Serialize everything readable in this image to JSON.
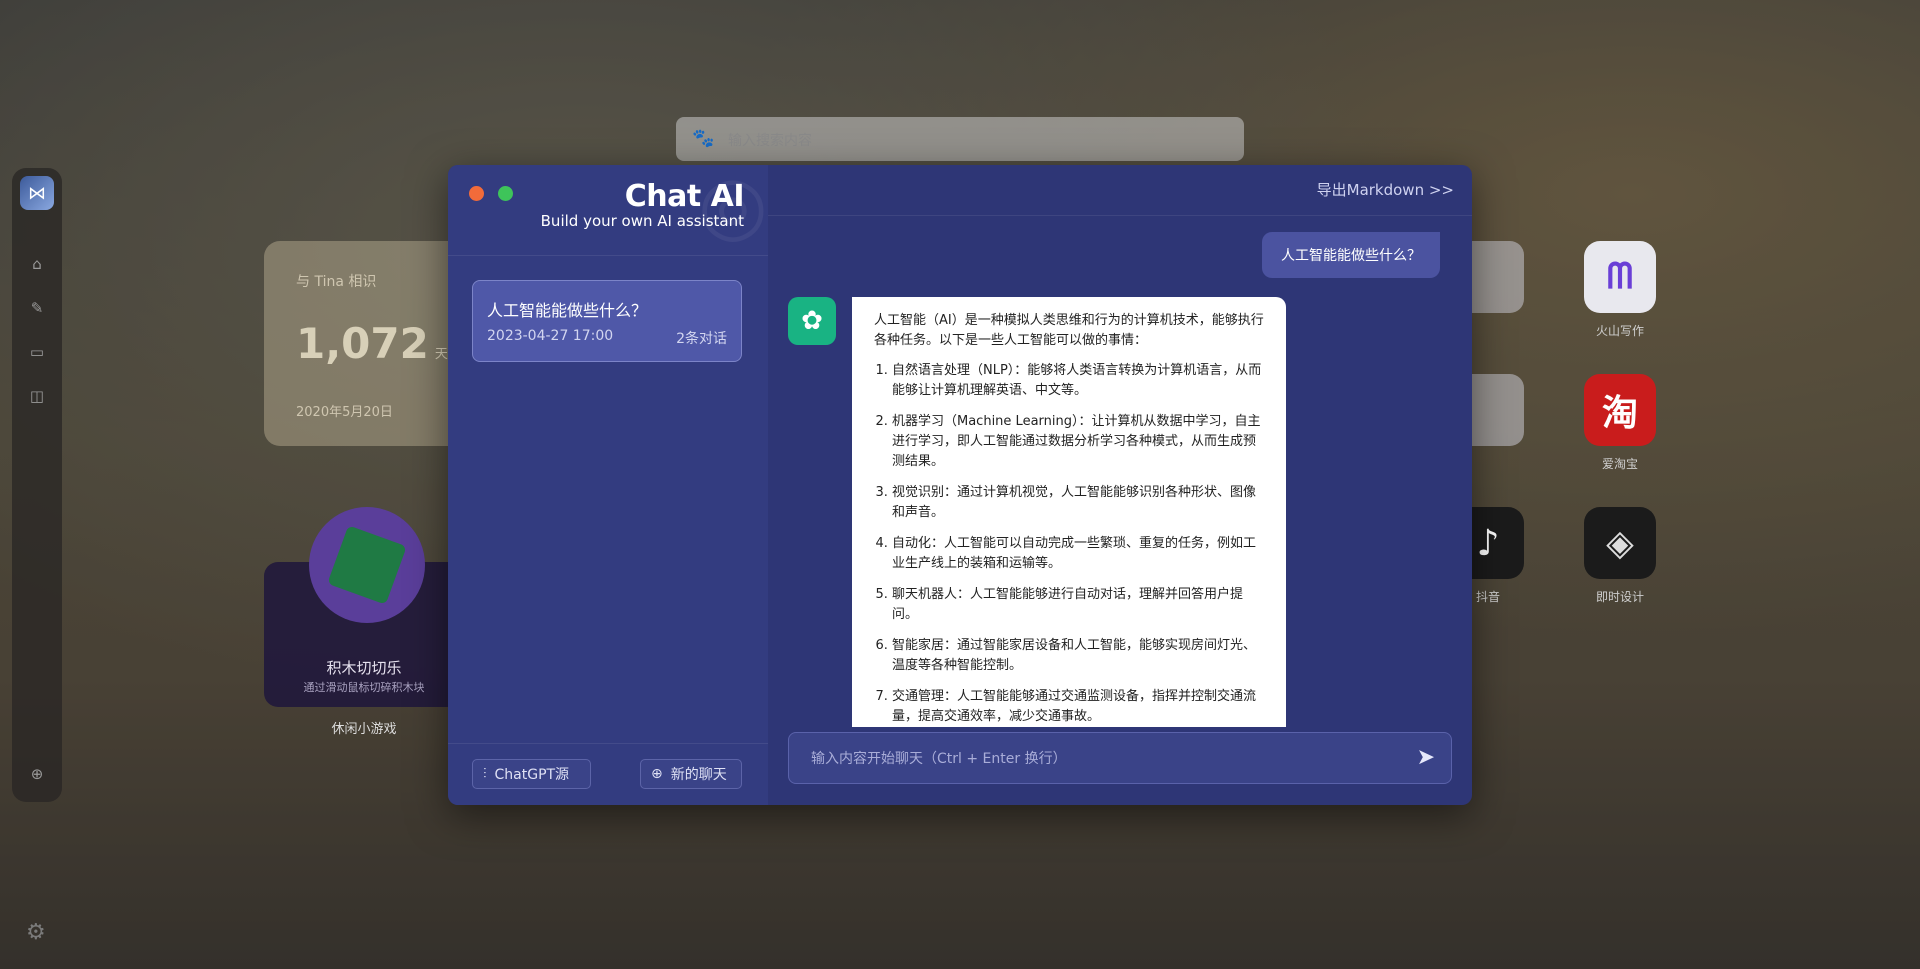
{
  "background": {
    "search_placeholder": "输入搜索内容",
    "date_widget": {
      "title": "与 Tina 相识",
      "days": "1,072",
      "unit": "天",
      "date": "2020年5月20日"
    },
    "game_widget": {
      "title": "积木切切乐",
      "subtitle": "通过滑动鼠标切碎积木块",
      "label": "休闲小游戏"
    },
    "apps": [
      {
        "name": "火山写作",
        "icon": "huoshan-icon"
      },
      {
        "name": "爱淘宝",
        "icon": "taobao-icon",
        "glyph": "淘"
      },
      {
        "name": "抖音",
        "icon": "douyin-icon"
      },
      {
        "name": "即时设计",
        "icon": "jishi-icon"
      }
    ]
  },
  "dialog": {
    "brand_title": "Chat AI",
    "brand_subtitle": "Build your own AI assistant",
    "export_label": "导出Markdown  >>",
    "conversation": {
      "title": "人工智能能做些什么？",
      "date": "2023-04-27 17:00",
      "count": "2条对话"
    },
    "source_button": "ChatGPT源",
    "new_chat_button": "新的聊天",
    "user_message": "人工智能能做些什么？",
    "ai_intro": "人工智能（AI）是一种模拟人类思维和行为的计算机技术，能够执行各种任务。以下是一些人工智能可以做的事情：",
    "ai_items": [
      "自然语言处理（NLP）：能够将人类语言转换为计算机语言，从而能够让计算机理解英语、中文等。",
      "机器学习（Machine Learning）：让计算机从数据中学习，自主进行学习，即人工智能通过数据分析学习各种模式，从而生成预测结果。",
      "视觉识别：通过计算机视觉，人工智能能够识别各种形状、图像和声音。",
      "自动化：人工智能可以自动完成一些繁琐、重复的任务，例如工业生产线上的装箱和运输等。",
      "聊天机器人：人工智能能够进行自动对话，理解并回答用户提问。",
      "智能家居：通过智能家居设备和人工智能，能够实现房间灯光、温度等各种智能控制。",
      "交通管理：人工智能能够通过交通监测设备，指挥并控制交通流量，提高交通效率，减少交通事故。"
    ],
    "input_placeholder": "输入内容开始聊天（Ctrl + Enter 换行）"
  },
  "colors": {
    "close": "#f26b3a",
    "minimize": "#3ec45a",
    "ai_avatar": "#19b383"
  }
}
